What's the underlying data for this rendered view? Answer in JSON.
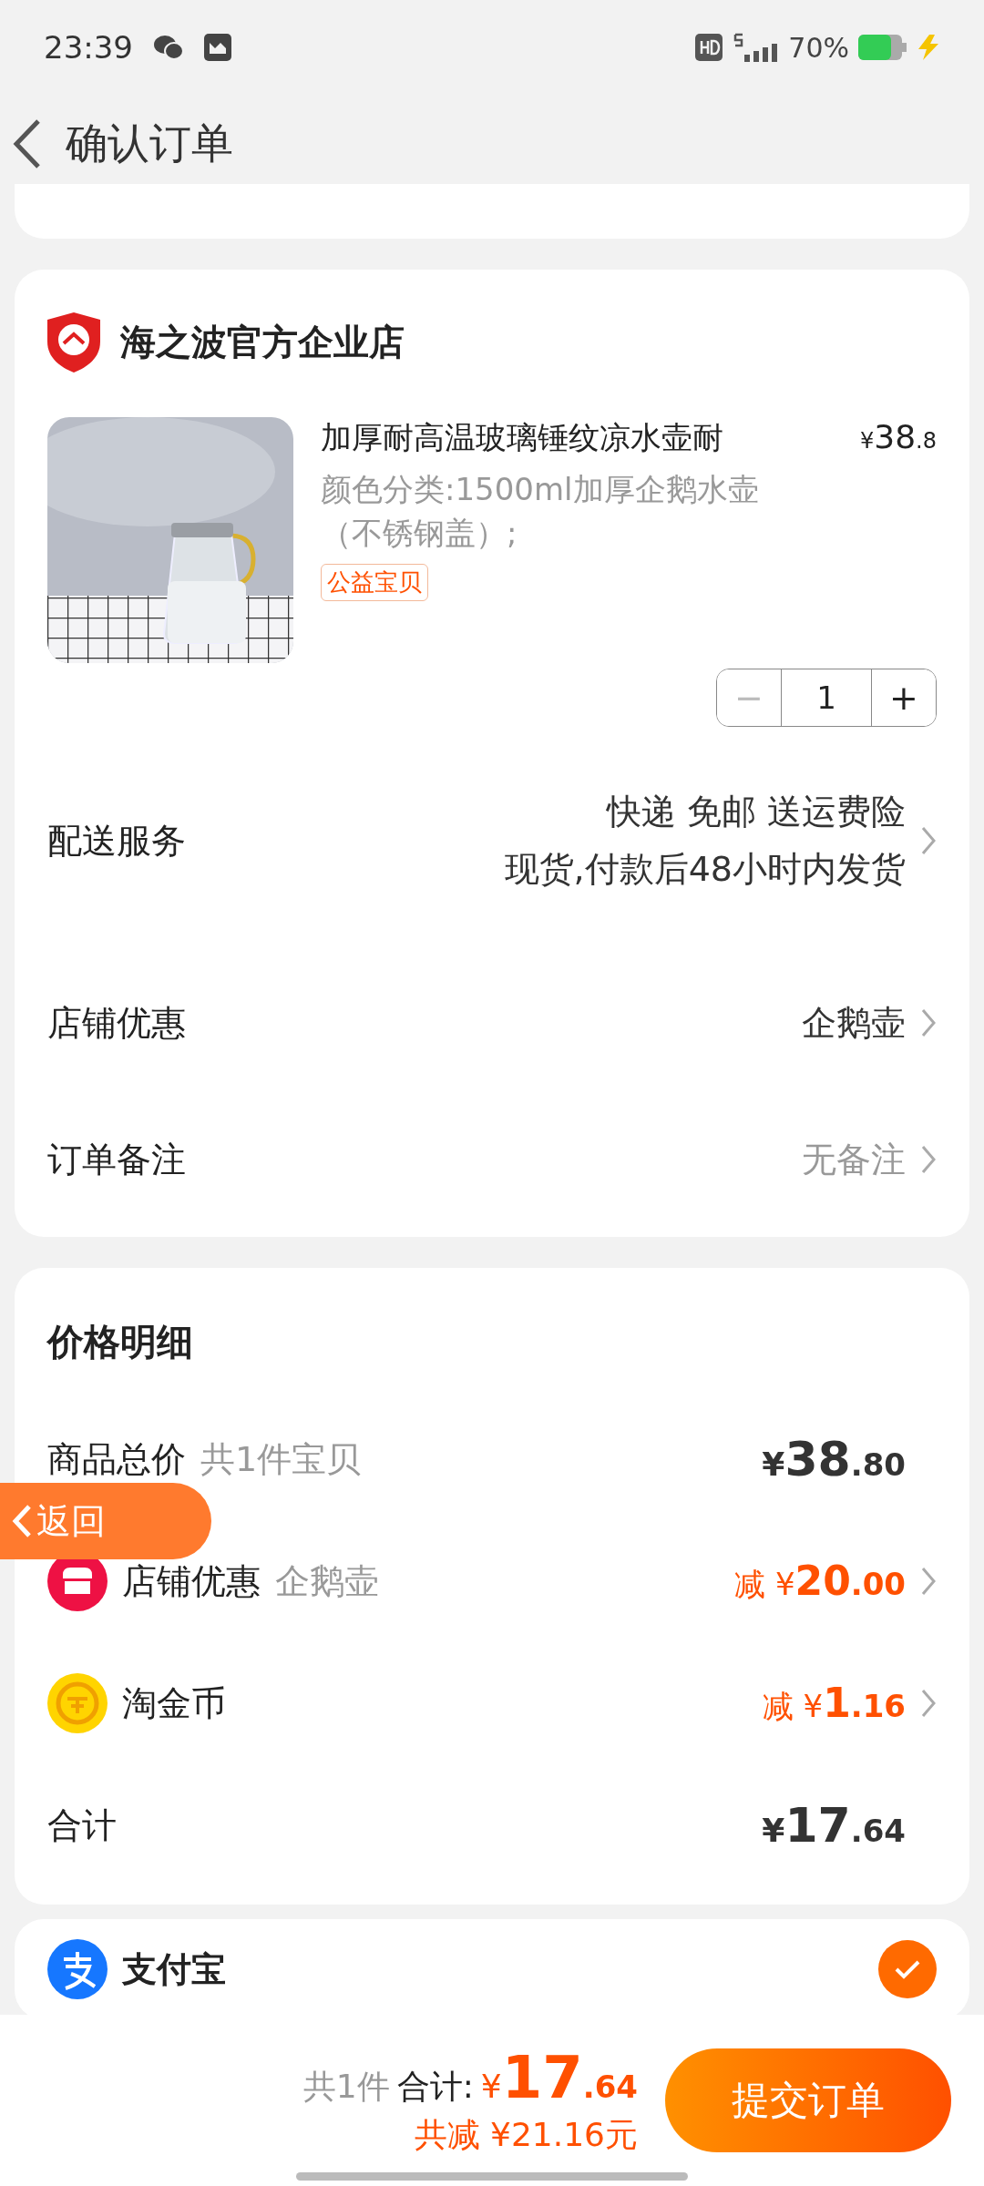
{
  "status_bar": {
    "time": "23:39",
    "battery": "70%"
  },
  "header": {
    "title": "确认订单"
  },
  "store": {
    "name": "海之波官方企业店",
    "product": {
      "kind": "picture",
      "title": "加厚耐高温玻璃锤纹凉水壶耐",
      "price": {
        "currency": "¥",
        "integer": "38",
        "decimal": ".8"
      },
      "spec": "颜色分类:1500ml加厚企鹅水壶（不锈钢盖）;",
      "tag": "公益宝贝",
      "quantity": "1",
      "minus": "−",
      "plus": "+"
    },
    "rows": [
      {
        "label": "配送服务",
        "values": [
          "快递 免邮 送运费险",
          "现货,付款后48小时内发货"
        ],
        "muted": false
      },
      {
        "label": "店铺优惠",
        "values": [
          "企鹅壶"
        ],
        "muted": false
      },
      {
        "label": "订单备注",
        "values": [
          "无备注"
        ],
        "muted": true
      }
    ]
  },
  "price_detail": {
    "title": "价格明细",
    "rows": [
      {
        "kind": "plain",
        "label": "商品总价",
        "note": "共1件宝贝",
        "amount": {
          "currency": "¥",
          "integer": "38",
          "decimal": ".80"
        },
        "discount": false,
        "chevron": false
      },
      {
        "kind": "shop",
        "label": "店铺优惠",
        "note": "企鹅壶",
        "amount": {
          "prefix": "减",
          "currency": "¥",
          "integer": "20",
          "decimal": ".00"
        },
        "discount": true,
        "chevron": true
      },
      {
        "kind": "coin",
        "label": "淘金币",
        "note": "",
        "amount": {
          "prefix": "减",
          "currency": "¥",
          "integer": "1",
          "decimal": ".16"
        },
        "discount": true,
        "chevron": true
      },
      {
        "kind": "plain",
        "label": "合计",
        "note": "",
        "amount": {
          "currency": "¥",
          "integer": "17",
          "decimal": ".64"
        },
        "discount": false,
        "chevron": false
      }
    ]
  },
  "payment_methods": [
    {
      "name": "支付宝",
      "selected": true
    }
  ],
  "float_button": {
    "label": "返回"
  },
  "bottom_bar": {
    "count": "共1件",
    "total_label": "合计:",
    "total": {
      "currency": "¥",
      "integer": "17",
      "decimal": ".64"
    },
    "saved": "共减 ¥21.16元",
    "submit": "提交订单"
  }
}
